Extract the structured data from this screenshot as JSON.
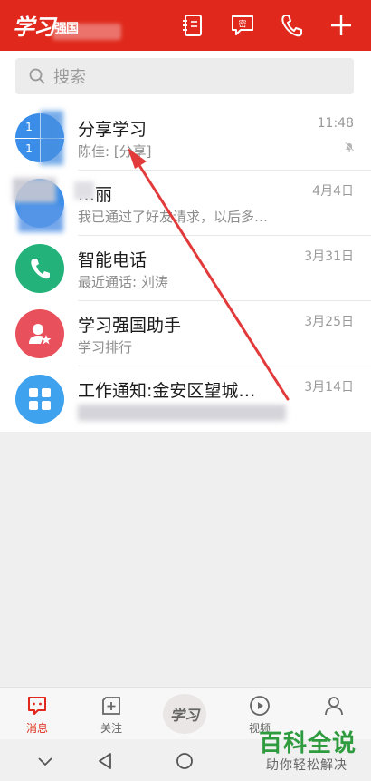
{
  "header": {
    "logo_main": "学习",
    "logo_small": "强国",
    "icons": [
      "notebook-icon",
      "secret-chat-icon",
      "phone-icon",
      "plus-icon"
    ],
    "secret_label": "密"
  },
  "search": {
    "placeholder": "搜索"
  },
  "conversations": [
    {
      "name": "分享学习",
      "subtitle": "陈佳: [分享]",
      "time": "11:48",
      "muted": true
    },
    {
      "name": "…丽",
      "subtitle": "我已通过了好友请求，以后多…",
      "time": "4月4日"
    },
    {
      "name": "智能电话",
      "subtitle": "最近通话: 刘涛",
      "time": "3月31日"
    },
    {
      "name": "学习强国助手",
      "subtitle": "学习排行",
      "time": "3月25日"
    },
    {
      "name": "工作通知:金安区望城…",
      "subtitle": "",
      "time": "3月14日"
    }
  ],
  "group_avatar": {
    "q1": "1",
    "q2": "1"
  },
  "tabbar": {
    "tabs": [
      {
        "label": "消息",
        "icon": "message-icon",
        "active": true
      },
      {
        "label": "关注",
        "icon": "follow-icon",
        "active": false
      },
      {
        "label": "学习",
        "icon": "xuexi-logo-icon",
        "active": false
      },
      {
        "label": "视频",
        "icon": "video-icon",
        "active": false
      },
      {
        "label": "",
        "icon": "profile-icon",
        "active": false
      }
    ]
  },
  "watermark": {
    "title": "百科全说",
    "subtitle": "助你轻松解决"
  },
  "colors": {
    "brand_red": "#e0291c",
    "accent_green": "#22b27a",
    "accent_blue": "#3a8de8",
    "accent_rose": "#e8505b"
  }
}
